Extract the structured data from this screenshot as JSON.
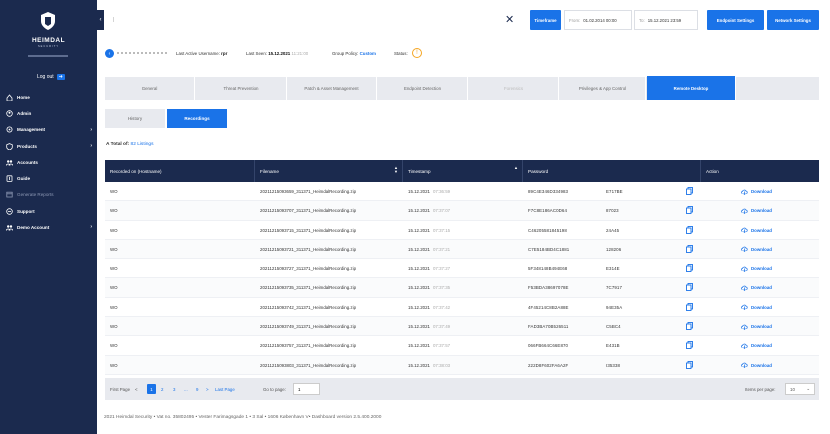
{
  "brand": {
    "name": "HEIMDAL",
    "sub": "SECURITY",
    "logo_icon": "heimdal-shield-icon"
  },
  "sidebar": {
    "logout_label": "Log out",
    "items": [
      {
        "label": "Home",
        "icon": "home-icon",
        "chevron": false,
        "muted": false
      },
      {
        "label": "Admin",
        "icon": "admin-icon",
        "chevron": false,
        "muted": false
      },
      {
        "label": "Management",
        "icon": "management-icon",
        "chevron": true,
        "muted": false
      },
      {
        "label": "Products",
        "icon": "products-icon",
        "chevron": true,
        "muted": false
      },
      {
        "label": "Accounts",
        "icon": "accounts-icon",
        "chevron": false,
        "muted": false
      },
      {
        "label": "Guide",
        "icon": "guide-icon",
        "chevron": false,
        "muted": false
      },
      {
        "label": "Generate Reports",
        "icon": "reports-icon",
        "chevron": false,
        "muted": true
      },
      {
        "label": "Support",
        "icon": "support-icon",
        "chevron": false,
        "muted": false
      },
      {
        "label": "Demo Account",
        "icon": "demo-account-icon",
        "chevron": true,
        "muted": false
      }
    ]
  },
  "topbar": {
    "search_value": "|",
    "timeframe_label": "Timeframe",
    "from_label": "From:",
    "from_value": "01.02.2014 00:00",
    "to_label": "To:",
    "to_value": "15.12.2021 23:59",
    "endpoint_settings_label": "Endpoint Settings",
    "network_settings_label": "Network Settings"
  },
  "info": {
    "last_active_label": "Last Active Username:",
    "last_active_value": "rpr",
    "last_seen_label": "Last Seen:",
    "last_seen_date": "15.12.2021",
    "last_seen_time": "11:21:00",
    "group_policy_label": "Group Policy:",
    "group_policy_value": "Custom",
    "status_label": "Status:"
  },
  "main_tabs": [
    {
      "label": "General",
      "state": "normal"
    },
    {
      "label": "Threat Prevention",
      "state": "normal"
    },
    {
      "label": "Patch & Asset Management",
      "state": "normal"
    },
    {
      "label": "Endpoint Detection",
      "state": "normal"
    },
    {
      "label": "Forensics",
      "state": "disabled"
    },
    {
      "label": "Privileges & App Control",
      "state": "normal"
    },
    {
      "label": "Remote Desktop",
      "state": "active"
    }
  ],
  "sub_tabs": [
    {
      "label": "History",
      "active": false
    },
    {
      "label": "Recordings",
      "active": true
    }
  ],
  "total": {
    "prefix": "A Total of:",
    "value": "82 Listings"
  },
  "table": {
    "headers": [
      "Recorded on (Hostname)",
      "Filename",
      "Timestamp",
      "Password",
      "Action"
    ],
    "action_label": "Download",
    "rows": [
      {
        "host": "WO",
        "filename": "20211215093659_311371_HeimdalRecording.zip",
        "date": "15.12.2021",
        "time": "07:36:59",
        "pw1": "89C4E346D334983",
        "pw2": "E717BE"
      },
      {
        "host": "WO",
        "filename": "20211215093707_311371_HeimdalRecording.zip",
        "date": "15.12.2021",
        "time": "07:37:07",
        "pw1": "F7C8E186AC0D64",
        "pw2": "87023"
      },
      {
        "host": "WO",
        "filename": "20211215093715_311371_HeimdalRecording.zip",
        "date": "15.12.2021",
        "time": "07:37:15",
        "pw1": "C46205581845198",
        "pw2": "24A45"
      },
      {
        "host": "WO",
        "filename": "20211215093721_311371_HeimdalRecording.zip",
        "date": "15.12.2021",
        "time": "07:37:21",
        "pw1": "C7E5184BD4C1881",
        "pw2": "128206"
      },
      {
        "host": "WO",
        "filename": "20211215093727_311371_HeimdalRecording.zip",
        "date": "15.12.2021",
        "time": "07:37:27",
        "pw1": "5F348148B494E68",
        "pw2": "E314E"
      },
      {
        "host": "WO",
        "filename": "20211215093735_311371_HeimdalRecording.zip",
        "date": "15.12.2021",
        "time": "07:37:35",
        "pw1": "F53BDA38697078E",
        "pw2": "7C7917"
      },
      {
        "host": "WO",
        "filename": "20211215093742_311371_HeimdalRecording.zip",
        "date": "15.12.2021",
        "time": "07:37:42",
        "pw1": "4F45214C8B2A88E",
        "pw2": "94E35A"
      },
      {
        "host": "WO",
        "filename": "20211215093749_311371_HeimdalRecording.zip",
        "date": "15.12.2021",
        "time": "07:37:49",
        "pw1": "FAD3BA70B526511",
        "pw2": "C5BC4"
      },
      {
        "host": "WO",
        "filename": "20211215093757_311371_HeimdalRecording.zip",
        "date": "15.12.2021",
        "time": "07:37:57",
        "pw1": "066FB664C66E870",
        "pw2": "E431B"
      },
      {
        "host": "WO",
        "filename": "20211215093803_311371_HeimdalRecording.zip",
        "date": "15.12.2021",
        "time": "07:38:03",
        "pw1": "222D8F602FA6A2F",
        "pw2": "I35338"
      }
    ]
  },
  "pager": {
    "first_label": "First Page",
    "prev": "<",
    "pages": [
      "1",
      "2",
      "3",
      "...",
      "9"
    ],
    "next": ">",
    "last_label": "Last Page",
    "goto_label": "Go to page:",
    "goto_value": "1",
    "ipp_label": "Items per page:",
    "ipp_value": "10"
  },
  "footer": "2021 Heimdal Security • Vat no. 35802495 • Vester Farimagsgade 1 • 3 Sal • 1606 København V• Dashboard version 2.5.400.2000",
  "colors": {
    "navy": "#1b2a4e",
    "accent": "#1a73e8",
    "status": "#f5a623"
  }
}
